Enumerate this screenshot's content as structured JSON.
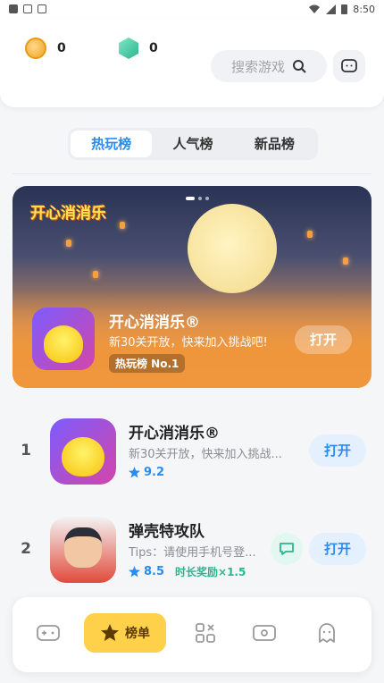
{
  "status": {
    "time": "8:50"
  },
  "wallet": {
    "coins": "0",
    "gems": "0"
  },
  "search": {
    "placeholder": "搜索游戏"
  },
  "tabs": [
    "热玩榜",
    "人气榜",
    "新品榜"
  ],
  "banner": {
    "logo_text": "开心消消乐",
    "title": "开心消消乐®",
    "subtitle": "新30关开放，快来加入挑战吧!",
    "badge": "热玩榜 No.1",
    "button": "打开"
  },
  "list": [
    {
      "rank": "1",
      "name": "开心消消乐®",
      "desc": "新30关开放，快来加入挑战...",
      "score": "9.2",
      "bonus": "",
      "button": "打开"
    },
    {
      "rank": "2",
      "name": "弹壳特攻队",
      "desc": "Tips：请使用手机号登...",
      "score": "8.5",
      "bonus": "时长奖励×1.5",
      "button": "打开"
    }
  ],
  "nav": {
    "active_label": "榜单"
  },
  "colors": {
    "accent": "#2a8cf0",
    "nav_active": "#ffd14a",
    "bonus": "#2bb58f"
  }
}
